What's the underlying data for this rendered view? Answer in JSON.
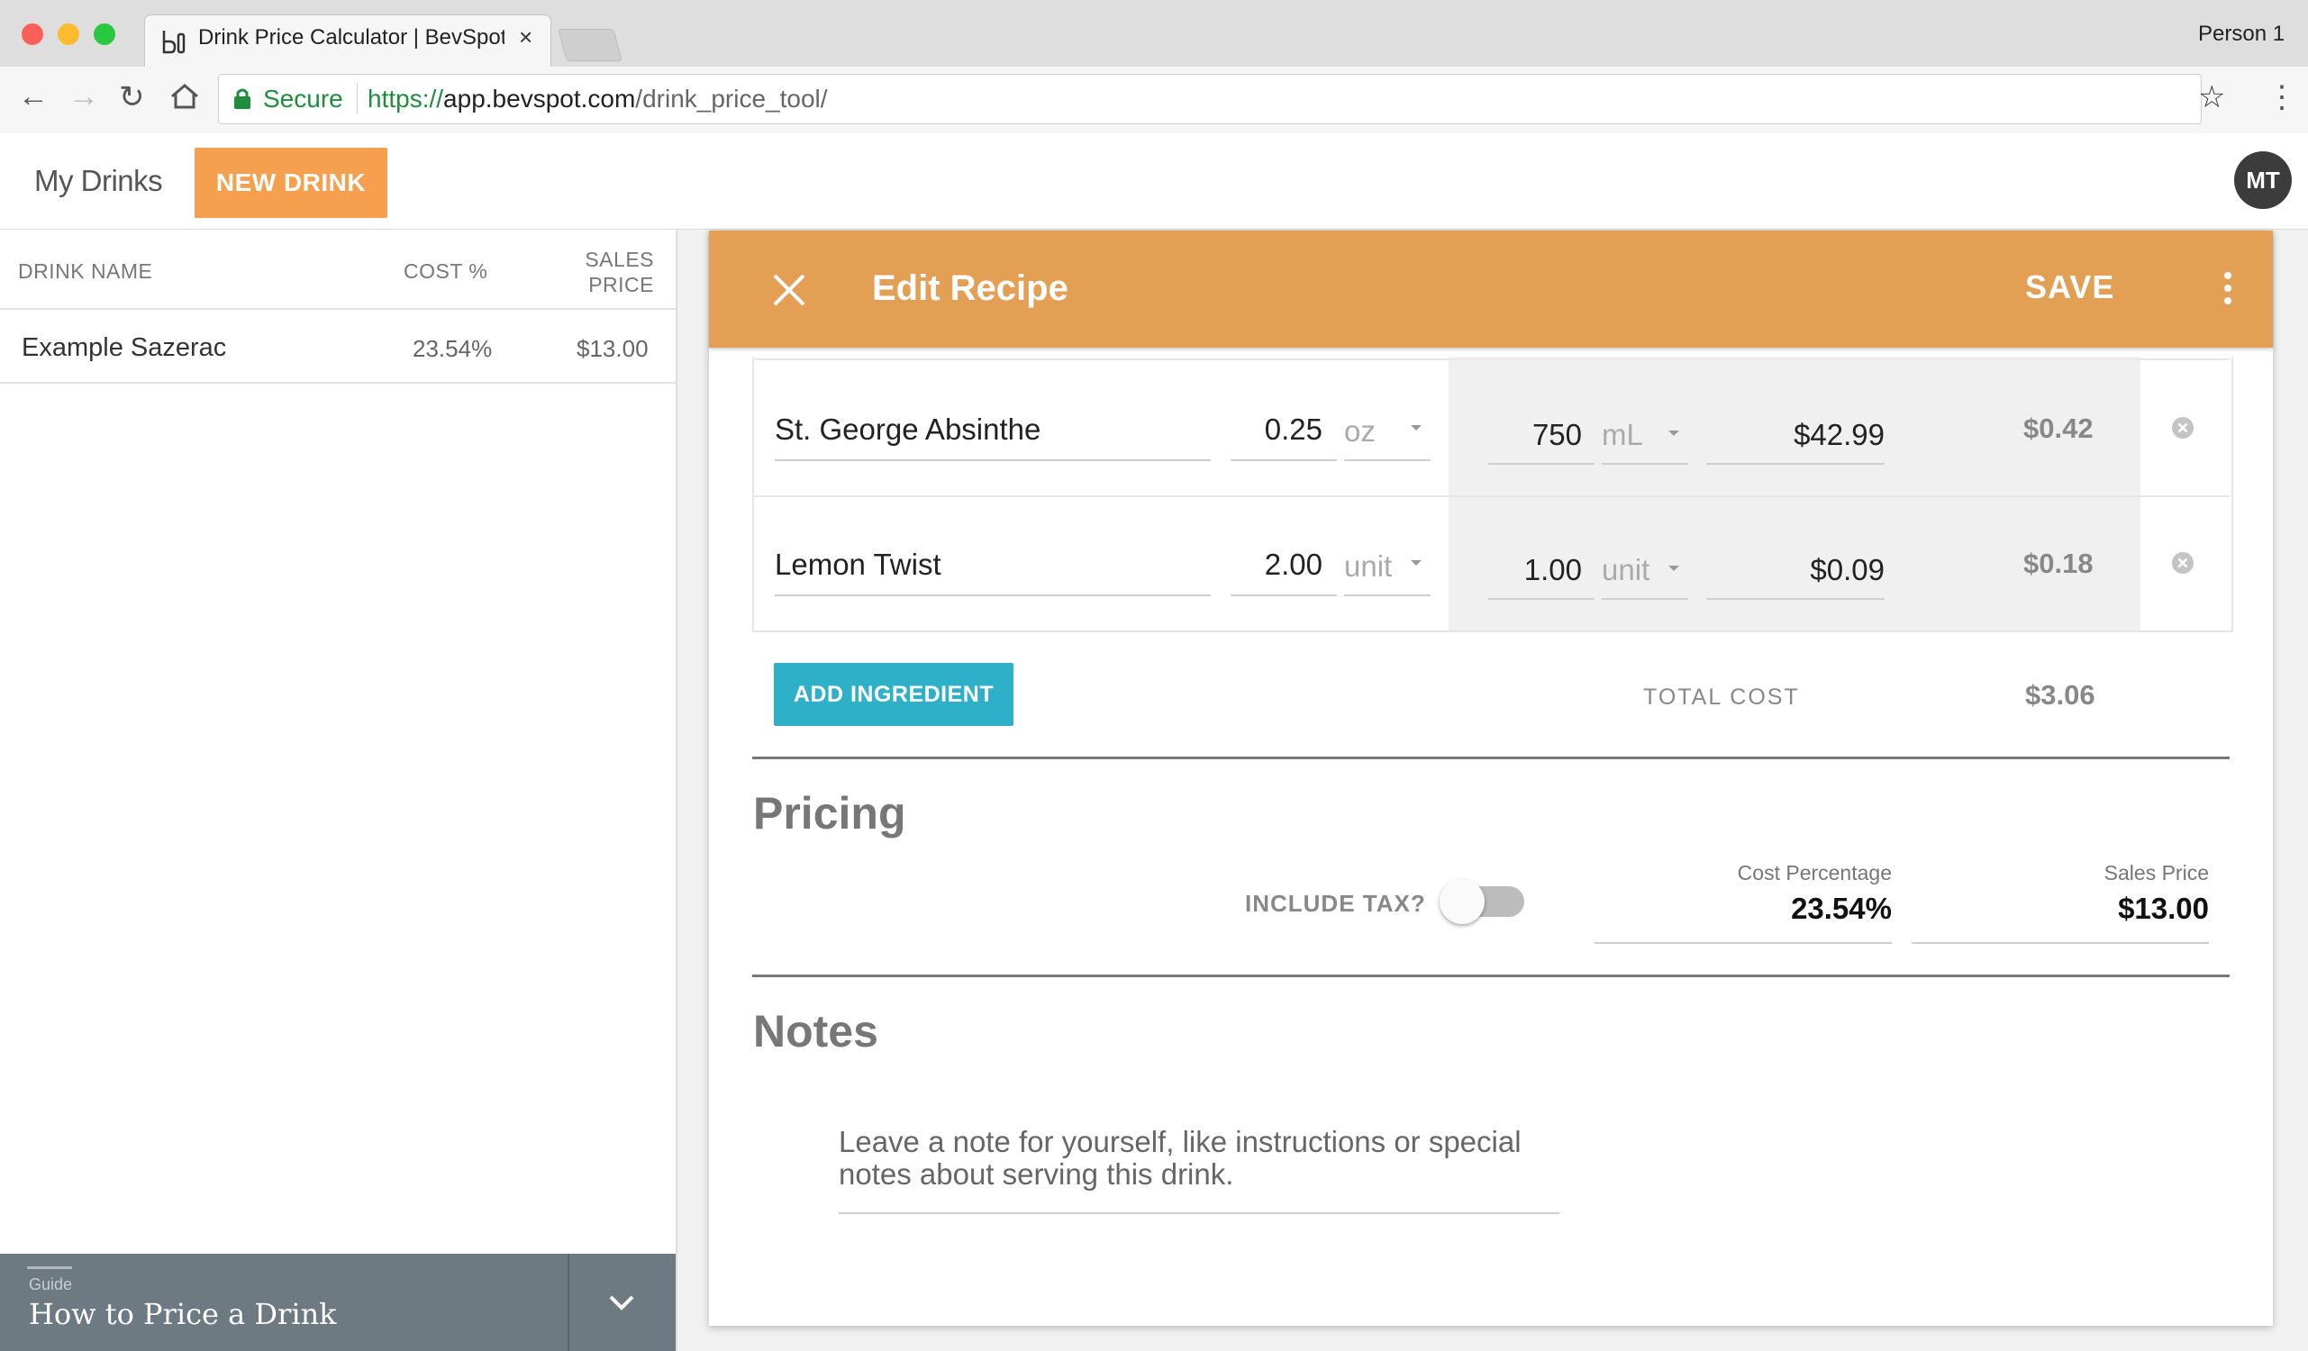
{
  "browser": {
    "tab_title": "Drink Price Calculator | BevSpot",
    "profile": "Person 1",
    "secure_label": "Secure",
    "url_scheme": "https://",
    "url_host": "app.bevspot.com",
    "url_path": "/drink_price_tool/"
  },
  "header": {
    "my_drinks": "My Drinks",
    "new_drink": "NEW DRINK",
    "avatar_initials": "MT",
    "accent": "#f4a04f"
  },
  "drink_list": {
    "columns": [
      "DRINK NAME",
      "COST %",
      "SALES PRICE"
    ],
    "rows": [
      {
        "name": "Example Sazerac",
        "cost_pct": "23.54%",
        "sales_price": "$13.00"
      }
    ]
  },
  "guide": {
    "label": "Guide",
    "title": "How to Price a Drink"
  },
  "edit_recipe": {
    "title": "Edit Recipe",
    "save": "SAVE",
    "header_color": "#e39f53",
    "ingredients": [
      {
        "name": "St. George Absinthe",
        "qty": "0.25",
        "unit": "oz",
        "bottle_size": "750",
        "bottle_unit": "mL",
        "bottle_price": "$42.99",
        "cost": "$0.42"
      },
      {
        "name": "Lemon Twist",
        "qty": "2.00",
        "unit": "unit",
        "bottle_size": "1.00",
        "bottle_unit": "unit",
        "bottle_price": "$0.09",
        "cost": "$0.18"
      }
    ],
    "add_ingredient": "ADD INGREDIENT",
    "total_cost_label": "TOTAL COST",
    "total_cost": "$3.06"
  },
  "pricing": {
    "title": "Pricing",
    "include_tax_label": "INCLUDE TAX?",
    "include_tax": false,
    "cost_percentage_label": "Cost Percentage",
    "cost_percentage": "23.54%",
    "sales_price_label": "Sales Price",
    "sales_price": "$13.00"
  },
  "notes": {
    "title": "Notes",
    "placeholder": "Leave a note for yourself, like instructions or special notes about serving this drink."
  }
}
